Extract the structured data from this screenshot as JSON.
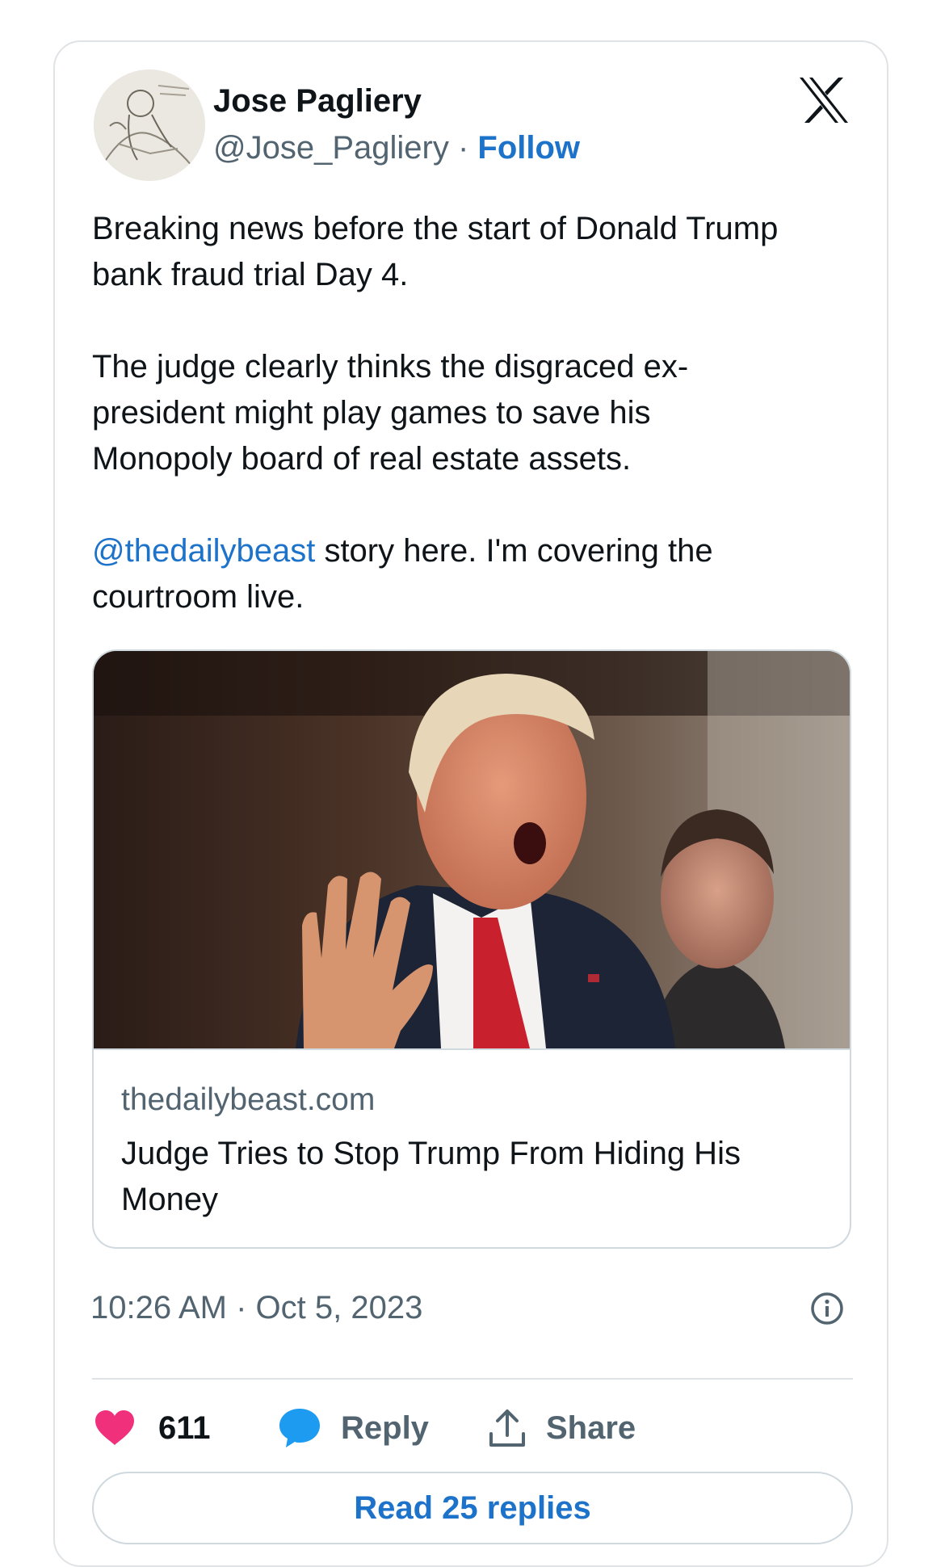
{
  "author": {
    "name": "Jose Pagliery",
    "handle": "@Jose_Pagliery",
    "separator": " · ",
    "follow_label": "Follow"
  },
  "tweet": {
    "para1": "Breaking news before the start of Donald Trump bank fraud trial Day 4.",
    "para2_line1": "The judge clearly thinks the disgraced ex-",
    "para2_line2": "president might play games to save his",
    "para2_line3": "Monopoly board of real estate assets.",
    "mention": "@thedailybeast",
    "para3_rest": " story here. I'm covering the courtroom live."
  },
  "link_card": {
    "domain": "thedailybeast.com",
    "title": "Judge Tries to Stop Trump From Hiding His Money"
  },
  "timestamp": "10:26 AM · Oct 5, 2023",
  "actions": {
    "likes": "611",
    "reply_label": "Reply",
    "share_label": "Share"
  },
  "read_replies_label": "Read 25 replies",
  "icons": {
    "brand": "x-logo-icon",
    "info": "info-icon",
    "like": "heart-icon",
    "reply": "speech-bubble-icon",
    "share": "share-upload-icon"
  },
  "colors": {
    "link": "#1d72c9",
    "secondary_text": "#536471",
    "like": "#f0307b",
    "reply_bubble": "#1d9bf0",
    "border": "#dfe3e6"
  }
}
